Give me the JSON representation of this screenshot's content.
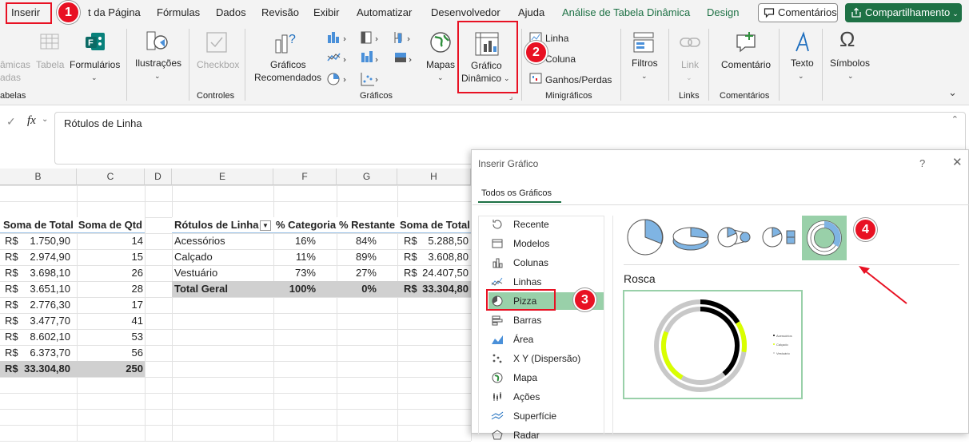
{
  "menubar": {
    "tabs": [
      "Inserir",
      "t da Página",
      "Fórmulas",
      "Dados",
      "Revisão",
      "Exibir",
      "Automatizar",
      "Desenvolvedor",
      "Ajuda",
      "Análise de Tabela Dinâmica",
      "Design"
    ],
    "comments_button": "Comentários",
    "share_button": "Compartilhamento"
  },
  "steps": [
    "1",
    "2",
    "3",
    "4"
  ],
  "ribbon": {
    "tabelas": {
      "item1": "âmicas",
      "item1b": "adas",
      "item2": "Tabela",
      "forms": "Formulários",
      "group": "abelas"
    },
    "ilustracoes": "Ilustrações",
    "controles": {
      "checkbox": "Checkbox",
      "group": "Controles"
    },
    "graficos": {
      "recomendados_1": "Gráficos",
      "recomendados_2": "Recomendados",
      "mapas": "Mapas",
      "dinamico_1": "Gráfico",
      "dinamico_2": "Dinâmico",
      "group": "Gráficos"
    },
    "minigraficos": {
      "linha": "Linha",
      "coluna": "Coluna",
      "ganhos": "Ganhos/Perdas",
      "group": "Minigráficos"
    },
    "filtros": "Filtros",
    "links": {
      "link": "Link",
      "group": "Links"
    },
    "comentarios": {
      "comentario": "Comentário",
      "group": "Comentários"
    },
    "texto": "Texto",
    "simbolos": "Símbolos"
  },
  "formula_bar": {
    "value": "Rótulos de Linha"
  },
  "columns": [
    "B",
    "C",
    "D",
    "E",
    "F",
    "G",
    "H"
  ],
  "left_table": {
    "headers": [
      "Soma de Total",
      "Soma de Qtd"
    ],
    "rows": [
      [
        "R$",
        "1.750,90",
        "14"
      ],
      [
        "R$",
        "2.974,90",
        "15"
      ],
      [
        "R$",
        "3.698,10",
        "26"
      ],
      [
        "R$",
        "3.651,10",
        "28"
      ],
      [
        "R$",
        "2.776,30",
        "17"
      ],
      [
        "R$",
        "3.477,70",
        "41"
      ],
      [
        "R$",
        "8.602,10",
        "53"
      ],
      [
        "R$",
        "6.373,70",
        "56"
      ]
    ],
    "total": [
      "R$",
      "33.304,80",
      "250"
    ]
  },
  "pivot": {
    "headers": [
      "Rótulos de Linha",
      "% Categoria",
      "% Restante",
      "Soma de Total"
    ],
    "rows": [
      [
        "Acessórios",
        "16%",
        "84%",
        "R$",
        "5.288,50"
      ],
      [
        "Calçado",
        "11%",
        "89%",
        "R$",
        "3.608,80"
      ],
      [
        "Vestuário",
        "73%",
        "27%",
        "R$",
        "24.407,50"
      ]
    ],
    "total": [
      "Total Geral",
      "100%",
      "0%",
      "R$",
      "33.304,80"
    ]
  },
  "dialog": {
    "title": "Inserir Gráfico",
    "help": "?",
    "tab": "Todos os Gráficos",
    "nav": [
      "Recente",
      "Modelos",
      "Colunas",
      "Linhas",
      "Pizza",
      "Barras",
      "Área",
      "X Y (Dispersão)",
      "Mapa",
      "Ações",
      "Superfície",
      "Radar"
    ],
    "selected_nav": "Pizza",
    "selected_subtype": "Rosca",
    "legend": [
      "Acessórios",
      "Calçado",
      "Vestuário"
    ]
  },
  "colors": {
    "accent_green": "#1e7145",
    "selection_green": "#99d0a9",
    "highlight": "#e81123",
    "doughnut_black": "#000000",
    "doughnut_yellow": "#d9ff00",
    "doughnut_gray": "#c8c8c8"
  }
}
